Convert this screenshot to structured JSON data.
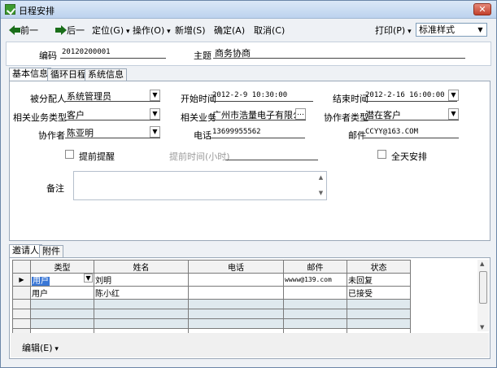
{
  "window": {
    "title": "日程安排"
  },
  "toolbar": {
    "prev": "前一",
    "next": "后一",
    "locate": "定位(G)",
    "operate": "操作(O)",
    "new": "新增(S)",
    "ok": "确定(A)",
    "cancel": "取消(C)",
    "print": "打印(P)",
    "style": "标准样式"
  },
  "header": {
    "code_label": "编码",
    "code_value": "20120200001",
    "subject_label": "主题",
    "subject_value": "商务协商"
  },
  "tabs": [
    "基本信息",
    "循环日程",
    "系统信息"
  ],
  "basic": {
    "assignee_label": "被分配人",
    "assignee_value": "系统管理员",
    "start_label": "开始时间",
    "start_value": "2012-2-9 10:30:00",
    "end_label": "结束时间",
    "end_value": "2012-2-16 16:00:00",
    "rel_type_label": "相关业务类型",
    "rel_type_value": "客户",
    "rel_biz_label": "相关业务",
    "rel_biz_value": "广州市浩量电子有限公司",
    "collab_type_label": "协作者类型",
    "collab_type_value": "潜在客户",
    "collab_label": "协作者",
    "collab_value": "陈亚明",
    "phone_label": "电话",
    "phone_value": "13699955562",
    "email_label": "邮件",
    "email_value": "CCYY@163.COM",
    "reminder_label": "提前提醒",
    "reminder_time_label": "提前时间(小时)",
    "allday_label": "全天安排",
    "remark_label": "备注"
  },
  "bottom_tabs": [
    "邀请人",
    "附件"
  ],
  "grid": {
    "headers": [
      "类型",
      "姓名",
      "电话",
      "邮件",
      "状态"
    ],
    "rows": [
      [
        "用户",
        "刘明",
        "",
        "wwww@139.com",
        "未回复"
      ],
      [
        "用户",
        "陈小红",
        "",
        "",
        "已接受"
      ]
    ]
  },
  "footer": {
    "edit": "编辑(E)"
  },
  "colors": {
    "titlebar": "#c9dbf1",
    "selection": "#3a77d6",
    "grid_filler": "#dfe9ee"
  }
}
